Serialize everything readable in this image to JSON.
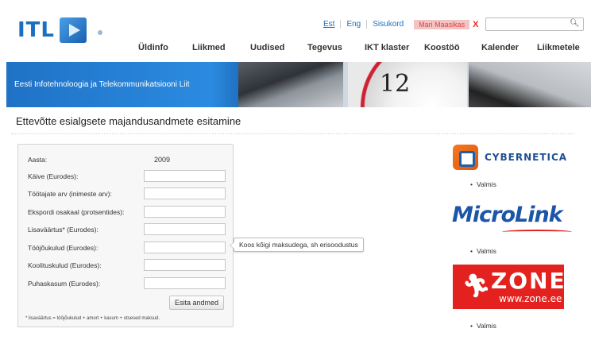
{
  "logo": {
    "text": "ITL"
  },
  "topbar": {
    "links": [
      "Est",
      "Eng",
      "Sisukord"
    ],
    "user_name": "Mari Maasikas",
    "logout_glyph": "X",
    "search_placeholder": ""
  },
  "nav": [
    "Üldinfo",
    "Liikmed",
    "Uudised",
    "Tegevus",
    "IKT klaster",
    "Koostöö",
    "Kalender",
    "Liikmetele"
  ],
  "banner": {
    "tagline": "Eesti Infotehnoloogia ja Telekommunikatsiooni Liit",
    "clock_numerals": "12"
  },
  "page": {
    "title": "Ettevõtte esialgsete majandusandmete esitamine"
  },
  "form": {
    "year_label": "Aasta:",
    "year_value": "2009",
    "fields": [
      {
        "label": "Käive (Eurodes):",
        "value": ""
      },
      {
        "label": "Töötajate arv (inimeste arv):",
        "value": ""
      },
      {
        "label": "Ekspordi osakaal (protsentides):",
        "value": ""
      },
      {
        "label": "Lisaväärtus* (Eurodes):",
        "value": ""
      },
      {
        "label": "Tööjõukulud (Eurodes):",
        "value": ""
      },
      {
        "label": "Koolituskulud (Eurodes):",
        "value": ""
      },
      {
        "label": "Puhaskasum (Eurodes):",
        "value": ""
      }
    ],
    "submit_label": "Esita andmed",
    "footnote": "* lisaväärtus = tööjõukulud + amort + kasum + otsesed maksud.",
    "tooltip": "Koos kõigi maksudega, sh erisoodustus"
  },
  "partners": {
    "cybernetica": {
      "name": "CYBERNETICA",
      "status": "Valmis"
    },
    "microlink": {
      "name": "MicroLink",
      "status": "Valmis"
    },
    "zone": {
      "name": "ZONE",
      "url": "www.zone.ee",
      "status": "Valmis"
    }
  },
  "colors": {
    "brand_blue": "#1a6fc0",
    "zone_red": "#e3221f",
    "microlink_blue": "#1b56a8",
    "cybernetica_orange": "#f37a20"
  }
}
